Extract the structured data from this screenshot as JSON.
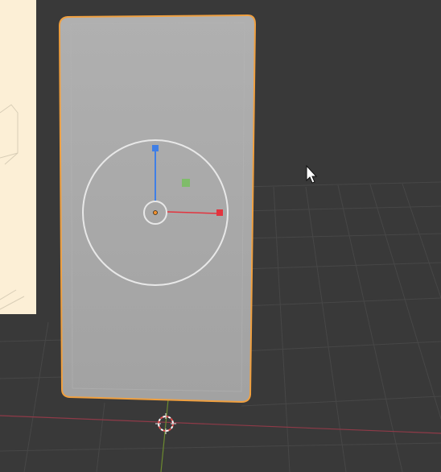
{
  "viewport": {
    "background": "#393939",
    "grid_color": "#474747",
    "x_axis_color": "#8f3a48",
    "y_axis_color": "#6c8a2f"
  },
  "reference_panel": {
    "fill": "#fcefd6",
    "sketch_stroke": "#d8cdb6"
  },
  "selected_object": {
    "fill": "#a9a9a9",
    "outline_color": "#f0a040",
    "shading_top": "#b0b0b0",
    "shading_bottom": "#a2a2a2"
  },
  "transform_gizmo": {
    "ring_color": "#e8e8e8",
    "z_axis_color": "#3f7fe6",
    "x_axis_color": "#e3343e",
    "plane_handle_color": "#74c05a",
    "origin_color": "#f09030"
  },
  "cursor_3d": {
    "primary": "#e05050",
    "secondary": "#ffffff"
  },
  "mouse_pointer": {
    "icon": "arrow-cursor-icon"
  }
}
